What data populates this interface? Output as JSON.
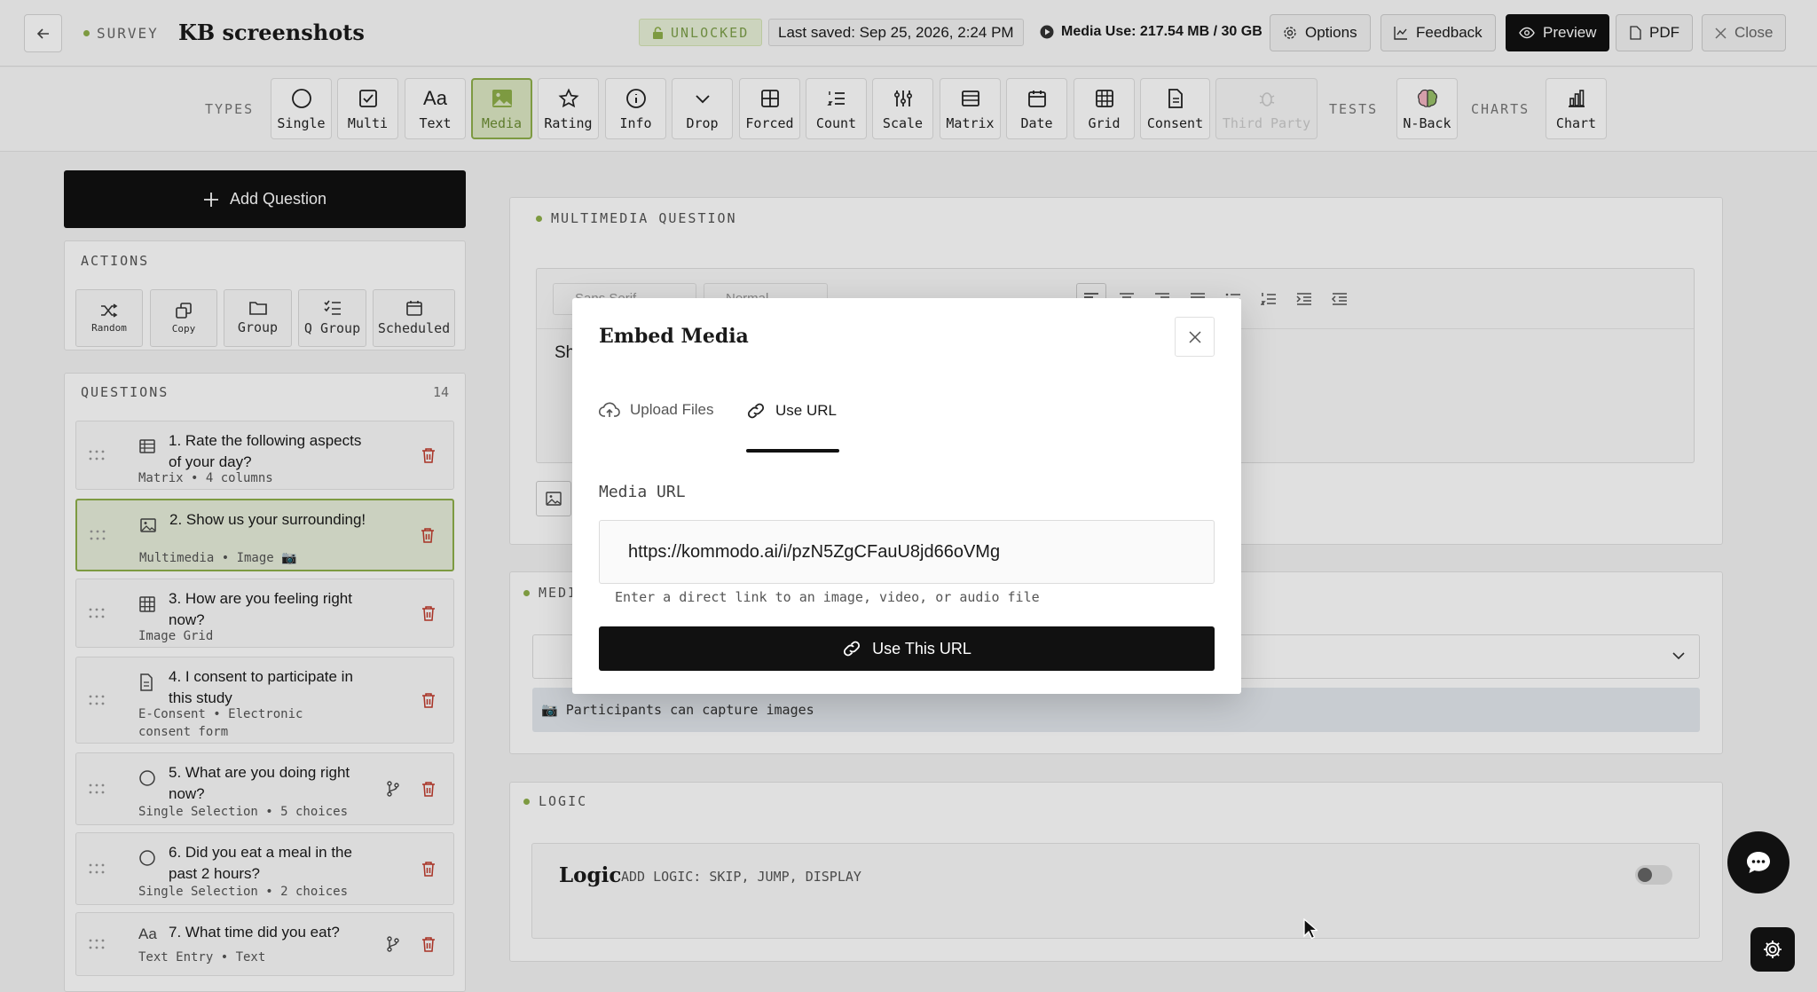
{
  "header": {
    "survey_tag": "SURVEY",
    "title": "KB screenshots",
    "unlocked": "UNLOCKED",
    "last_saved": "Last saved: Sep 25, 2026, 2:24 PM",
    "media_use": "Media Use: 217.54 MB / 30 GB",
    "buttons": {
      "options": "Options",
      "feedback": "Feedback",
      "preview": "Preview",
      "pdf": "PDF",
      "close": "Close"
    }
  },
  "toolbar": {
    "types_label": "TYPES",
    "tests_label": "TESTS",
    "charts_label": "CHARTS",
    "types": [
      {
        "label": "Single",
        "icon": "circle-icon"
      },
      {
        "label": "Multi",
        "icon": "checkbox-icon"
      },
      {
        "label": "Text",
        "icon": "text-aa-icon"
      },
      {
        "label": "Media",
        "icon": "image-icon",
        "active": true
      },
      {
        "label": "Rating",
        "icon": "star-icon"
      },
      {
        "label": "Info",
        "icon": "info-icon"
      },
      {
        "label": "Drop",
        "icon": "chevron-down-icon"
      },
      {
        "label": "Forced",
        "icon": "grid-4-icon"
      },
      {
        "label": "Count",
        "icon": "numbered-list-icon"
      },
      {
        "label": "Scale",
        "icon": "sliders-icon"
      },
      {
        "label": "Matrix",
        "icon": "table-icon"
      },
      {
        "label": "Date",
        "icon": "calendar-icon"
      },
      {
        "label": "Grid",
        "icon": "grid-icon"
      },
      {
        "label": "Consent",
        "icon": "document-icon"
      },
      {
        "label": "Third Party",
        "icon": "bug-icon",
        "disabled": true
      }
    ],
    "tests": [
      {
        "label": "N-Back",
        "icon": "brain-icon"
      }
    ],
    "charts": [
      {
        "label": "Chart",
        "icon": "bar-chart-icon"
      }
    ]
  },
  "sidebar": {
    "add_question": "Add Question",
    "actions_title": "ACTIONS",
    "actions": [
      {
        "label": "Random",
        "icon": "shuffle-icon"
      },
      {
        "label": "Copy",
        "icon": "copy-icon"
      },
      {
        "label": "Group",
        "icon": "folder-icon"
      },
      {
        "label": "Q Group",
        "icon": "checklist-icon"
      },
      {
        "label": "Scheduled",
        "icon": "calendar-icon"
      }
    ],
    "questions_title": "QUESTIONS",
    "questions_count": "14",
    "questions": [
      {
        "title": "1. Rate the following aspects of your day?",
        "sub": "Matrix • 4 columns",
        "icon": "table-icon"
      },
      {
        "title": "2. Show us your surrounding!",
        "sub": "Multimedia • Image 📷",
        "icon": "image-icon",
        "selected": true
      },
      {
        "title": "3. How are you feeling right now?",
        "sub": "Image Grid",
        "icon": "grid-icon"
      },
      {
        "title": "4. I consent to participate in this study",
        "sub": "E-Consent • Electronic consent form",
        "icon": "document-icon"
      },
      {
        "title": "5. What are you doing right now?",
        "sub": "Single Selection • 5 choices",
        "icon": "circle-icon",
        "branch": true
      },
      {
        "title": "6. Did you eat a meal in the past 2 hours?",
        "sub": "Single Selection • 2 choices",
        "icon": "circle-icon"
      },
      {
        "title": "7. What time did you eat?",
        "sub": "Text Entry • Text",
        "icon": "text-aa-icon",
        "branch": true
      }
    ]
  },
  "main": {
    "multimedia_title": "MULTIMEDIA QUESTION",
    "editor_font": "Sans Serif",
    "editor_size": "Normal",
    "editor_text_partial": "Sh",
    "media_section_title": "MEDI",
    "capture_note": "📷 Participants can capture images",
    "logic_section_title": "LOGIC",
    "logic_heading": "Logic",
    "logic_sub": "ADD LOGIC: SKIP, JUMP, DISPLAY"
  },
  "modal": {
    "title": "Embed Media",
    "tab_upload": "Upload Files",
    "tab_url": "Use URL",
    "field_label": "Media URL",
    "url_value": "https://kommodo.ai/i/pzN5ZgCFauU8jd66oVMg",
    "hint": "Enter a direct link to an image, video, or audio file",
    "submit": "Use This URL"
  },
  "colors": {
    "accent": "#8fb04a",
    "dark": "#111111",
    "danger": "#c0392b"
  }
}
